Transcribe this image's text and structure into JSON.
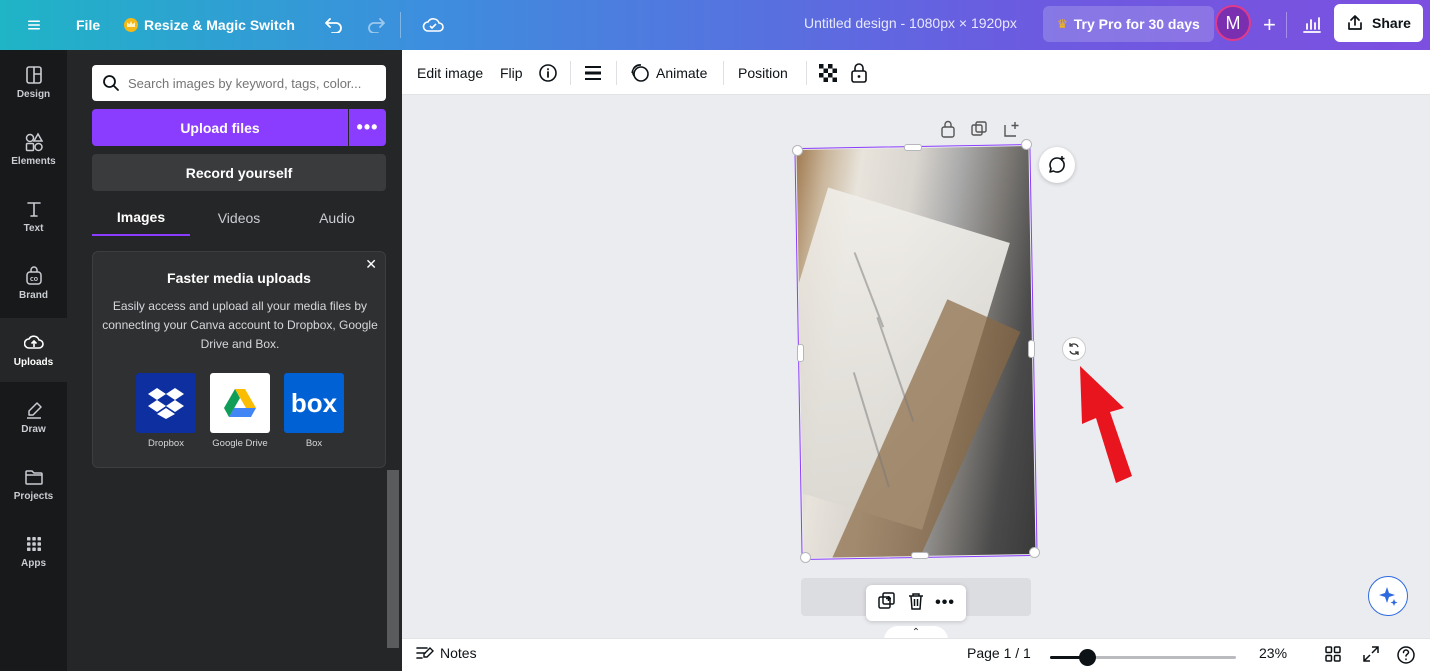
{
  "topbar": {
    "file_label": "File",
    "resize_label": "Resize & Magic Switch",
    "design_title": "Untitled design - 1080px × 1920px",
    "pro_label": "Try Pro for 30 days",
    "avatar_initial": "M",
    "share_label": "Share"
  },
  "rail": {
    "items": [
      {
        "label": "Design",
        "icon": "layout-icon"
      },
      {
        "label": "Elements",
        "icon": "shapes-icon"
      },
      {
        "label": "Text",
        "icon": "text-icon"
      },
      {
        "label": "Brand",
        "icon": "brand-icon"
      },
      {
        "label": "Uploads",
        "icon": "cloud-upload-icon"
      },
      {
        "label": "Draw",
        "icon": "pen-icon"
      },
      {
        "label": "Projects",
        "icon": "folder-icon"
      },
      {
        "label": "Apps",
        "icon": "grid-icon"
      }
    ],
    "active": "Uploads"
  },
  "panel": {
    "search_placeholder": "Search images by keyword, tags, color...",
    "upload_label": "Upload files",
    "record_label": "Record yourself",
    "tabs": [
      "Images",
      "Videos",
      "Audio"
    ],
    "active_tab": "Images",
    "promo": {
      "title": "Faster media uploads",
      "text": "Easily access and upload all your media files by connecting your Canva account to Dropbox, Google Drive and Box.",
      "services": [
        "Dropbox",
        "Google Drive",
        "Box"
      ],
      "box_logo_text": "box"
    }
  },
  "toolbar": {
    "edit_image": "Edit image",
    "flip": "Flip",
    "animate": "Animate",
    "position": "Position"
  },
  "bottombar": {
    "notes": "Notes",
    "page_label": "Page 1 / 1",
    "zoom": "23%",
    "zoom_fraction": 0.2
  },
  "colors": {
    "accent": "#8b3dff",
    "arrow": "#e8141e"
  }
}
